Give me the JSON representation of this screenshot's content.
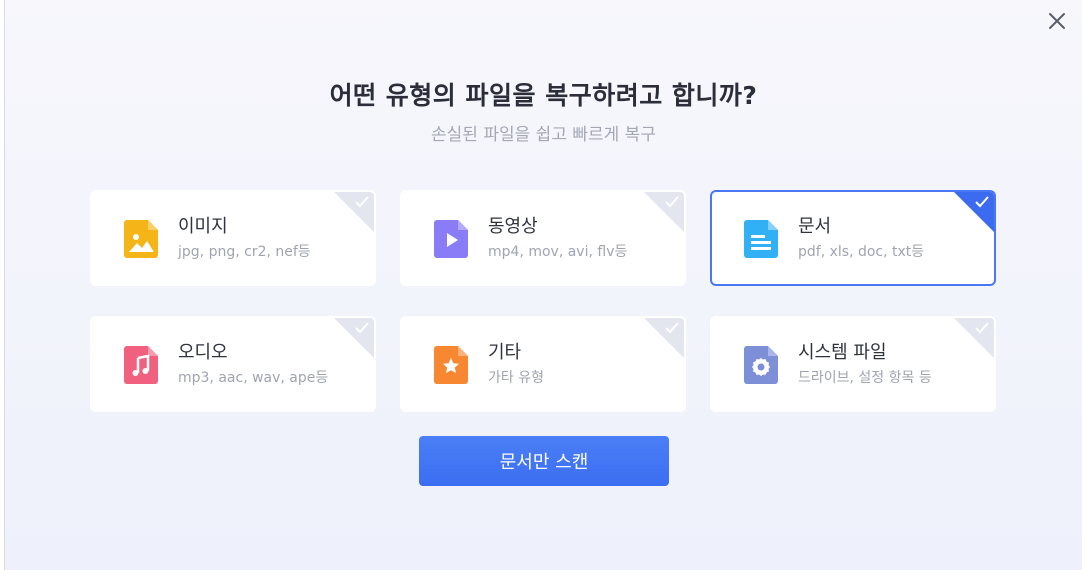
{
  "dialog": {
    "title": "어떤 유형의 파일을 복구하려고 합니까?",
    "subtitle": "손실된 파일을 쉽고 빠르게 복구",
    "close_icon": "close-icon"
  },
  "cards": [
    {
      "name": "이미지",
      "desc": "jpg, png, cr2, nef등",
      "icon": "image-file-icon",
      "color": "#f5b417",
      "selected": false
    },
    {
      "name": "동영상",
      "desc": "mp4, mov, avi, flv등",
      "icon": "video-file-icon",
      "color": "#8a7cf6",
      "selected": false
    },
    {
      "name": "문서",
      "desc": "pdf, xls, doc, txt등",
      "icon": "document-file-icon",
      "color": "#32b0f6",
      "selected": true
    },
    {
      "name": "오디오",
      "desc": "mp3, aac, wav, ape등",
      "icon": "audio-file-icon",
      "color": "#f1607f",
      "selected": false
    },
    {
      "name": "기타",
      "desc": "가타 유형",
      "icon": "other-file-icon",
      "color": "#f88732",
      "selected": false
    },
    {
      "name": "시스템 파일",
      "desc": "드라이브, 설정 항목 등",
      "icon": "system-file-icon",
      "color": "#7d8fd6",
      "selected": false
    }
  ],
  "scan_button": {
    "label": "문서만 스캔"
  },
  "colors": {
    "accent": "#3c6bf0",
    "selected_border": "#4a78f2"
  }
}
